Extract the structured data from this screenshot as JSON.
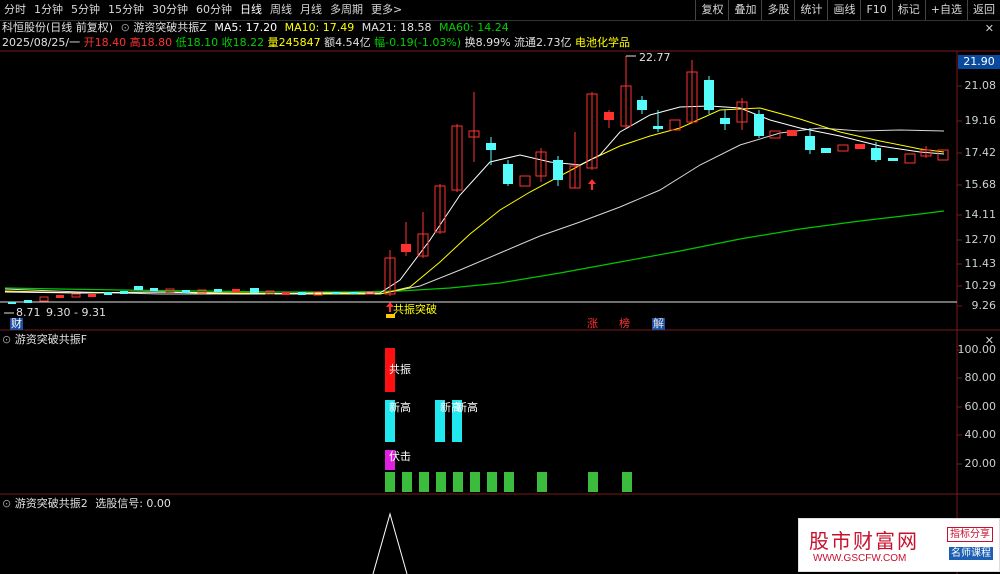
{
  "toolbar": {
    "periods": [
      "分时",
      "1分钟",
      "5分钟",
      "15分钟",
      "30分钟",
      "60分钟",
      "日线",
      "周线",
      "月线",
      "多周期",
      "更多>"
    ],
    "active_period": "日线",
    "right_buttons": [
      "复权",
      "叠加",
      "多股",
      "统计",
      "画线",
      "F10",
      "标记",
      "+自选",
      "返回"
    ]
  },
  "header": {
    "stock_name": "科恒股份(日线 前复权)",
    "indicator_name": "游资突破共振Z",
    "ma5": "MA5: 17.20",
    "ma10": "MA10: 17.49",
    "ma21": "MA21: 18.58",
    "ma60": "MA60: 14.24",
    "date": "2025/08/25/一",
    "open": "开18.40",
    "high": "高18.80",
    "low": "低18.10",
    "close": "收18.22",
    "volume": "量245847",
    "amount": "额4.54亿",
    "change": "幅-0.19(-1.03%)",
    "turnover": "换8.99%",
    "float": "流通2.73亿",
    "sector": "电池化学品"
  },
  "main_axis": {
    "labels": [
      "21.90",
      "21.08",
      "19.16",
      "17.42",
      "15.68",
      "14.11",
      "12.70",
      "11.43",
      "10.29",
      "9.26"
    ],
    "current_price": "21.90"
  },
  "main_labels": {
    "peak": "22.77",
    "low_mark": "8.71",
    "range": "9.30 - 9.31",
    "cai": "财",
    "breakout": "共振突破",
    "zhang": "涨",
    "bang": "榜",
    "jie": "解"
  },
  "panel1": {
    "title": "游资突破共振F",
    "axis": [
      "100.00",
      "80.00",
      "60.00",
      "40.00",
      "20.00"
    ],
    "labels": {
      "gongzhen": "共振",
      "xingao1": "新高",
      "xingao2": "新高",
      "xingao3": "新高",
      "fuji": "伏击"
    }
  },
  "panel2": {
    "title": "游资突破共振2",
    "signal": "选股信号: 0.00"
  },
  "watermark": {
    "cn": "股市财富网",
    "url": "WWW.GSCFW.COM",
    "tag1": "指标分享",
    "tag2": "名师课程"
  },
  "colors": {
    "up": "#ff3232",
    "down": "#54fcfc",
    "ma5": "#ffffff",
    "ma10": "#ffff00",
    "ma21": "#d0d0d0",
    "ma60": "#00c800",
    "bg": "#000000"
  }
}
